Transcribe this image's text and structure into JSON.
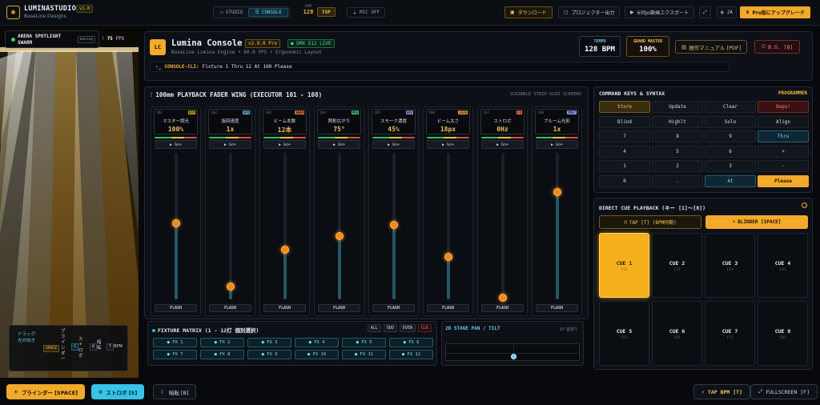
{
  "app": {
    "name": "LUMINASTUDIO",
    "company": "BaseLine Designs",
    "version": "v1.0"
  },
  "topbar": {
    "studio": "STUDIO",
    "console": "CONSOLE",
    "bpm_label": "BPM",
    "bpm_value": "128",
    "tap": "TAP",
    "mic": "MIC OFF",
    "download": "ダウンロード",
    "projector": "プロジェクター出力",
    "export": "60fps動画エクスポート",
    "lang": "JA",
    "upgrade": "Pro版にアップグレード"
  },
  "stage": {
    "arena_title": "ARENA SPOTLIGHT SWARM",
    "arena_state": "moving",
    "fps_value": "75",
    "fps_label": "FPS",
    "hint_drag": "ドラッグ: 光の向き",
    "hint_key1": "SPACE",
    "hint_label1": "ブラインダー",
    "hint_key2": "S",
    "hint_label2": "ストロボ",
    "hint_key3": "B",
    "hint_label3": "暗転",
    "hint_key4": "T",
    "hint_label4": "BPM"
  },
  "console": {
    "badge": "LC",
    "title": "Lumina Console",
    "version": "v2.0.0 Pro",
    "dmx": "DMX 512 LIVE",
    "subtitle": "BaseLine Lumina Engine • 60.0 FPS • Ergonomic Layout",
    "cli_prompt": "CONSOLE-CLI:",
    "cli_command": "Fixture 1 Thru 12 At 100 Please",
    "tempo_label": "TEMPO",
    "tempo_value": "128 BPM",
    "master_label": "GRAND MASTER",
    "master_value": "100%",
    "manual": "操作マニュアル [PDF]",
    "blackout": "B.O. [B]"
  },
  "wing": {
    "title": "100mm PLAYBACK FADER WING (EXECUTOR 101 - 108)",
    "subtitle": "SCRIBBLE STRIP OLED SCREENS",
    "go_label": "Go+",
    "flash_label": "FLASH",
    "faders": [
      {
        "num": "101",
        "tag": "DIM",
        "tag_color": "#e8a417",
        "name": "マスター調光",
        "value": "100%",
        "level": 0.52
      },
      {
        "num": "102",
        "tag": "SPD",
        "tag_color": "#5fb8ee",
        "name": "旋回速度",
        "value": "1x",
        "level": 0.09
      },
      {
        "num": "103",
        "tag": "BEAM",
        "tag_color": "#f07a3a",
        "name": "ビーム本数",
        "value": "12本",
        "level": 0.34
      },
      {
        "num": "104",
        "tag": "POS",
        "tag_color": "#39d17a",
        "name": "照射広がり",
        "value": "75°",
        "level": 0.43
      },
      {
        "num": "105",
        "tag": "ENV",
        "tag_color": "#b98cf0",
        "name": "スモーク濃度",
        "value": "45%",
        "level": 0.51
      },
      {
        "num": "106",
        "tag": "SIZE",
        "tag_color": "#f0a03a",
        "name": "ビーム太さ",
        "value": "18px",
        "level": 0.29
      },
      {
        "num": "107",
        "tag": "FX",
        "tag_color": "#ff6a5a",
        "name": "ストロボ",
        "value": "0Hz",
        "level": 0.01
      },
      {
        "num": "108",
        "tag": "POST",
        "tag_color": "#8aa8ff",
        "name": "ブルーム光彩",
        "value": "1x",
        "level": 0.73
      }
    ]
  },
  "fixtures": {
    "title": "FIXTURE MATRIX (1 - 12灯 個別選択)",
    "all": "ALL",
    "odd": "ODD",
    "even": "EVEN",
    "clr": "CLR",
    "items": [
      "FX 1",
      "FX 2",
      "FX 3",
      "FX 4",
      "FX 5",
      "FX 6",
      "FX 7",
      "FX 8",
      "FX 9",
      "FX 10",
      "FX 11",
      "FX 12"
    ]
  },
  "pantilt": {
    "title": "2D STAGE PAN / TILT",
    "subtitle": "XY 首振り"
  },
  "keypad": {
    "title": "COMMAND KEYS & SYNTAX",
    "mode": "PROGRAMMER",
    "keys": [
      "Store",
      "Update",
      "Clear",
      "Oops!",
      "Blind",
      "Highlt",
      "Solo",
      "Align",
      "7",
      "8",
      "9",
      "Thru",
      "4",
      "5",
      "6",
      "+",
      "1",
      "2",
      "3",
      "-",
      "0",
      ".",
      "At",
      "Please"
    ]
  },
  "cues": {
    "title": "DIRECT CUE PLAYBACK (キー [1]〜[8])",
    "tap": "TAP [T] (BPM同期)",
    "blinder": "BLINDER [SPACE]",
    "items": [
      {
        "name": "CUE 1",
        "key": "[1]"
      },
      {
        "name": "CUE 2",
        "key": "[2]"
      },
      {
        "name": "CUE 3",
        "key": "[3]"
      },
      {
        "name": "CUE 4",
        "key": "[4]"
      },
      {
        "name": "CUE 5",
        "key": "[5]"
      },
      {
        "name": "CUE 6",
        "key": "[6]"
      },
      {
        "name": "CUE 7",
        "key": "[7]"
      },
      {
        "name": "CUE 8",
        "key": "[8]"
      }
    ]
  },
  "bottom": {
    "blinder": "ブラインダー [SPACE]",
    "strobe": "ストロボ [S]",
    "dark": "暗転 [B]",
    "tap_bpm": "TAP BPM [T]",
    "fullscreen": "FULLSCREEN [F]"
  }
}
